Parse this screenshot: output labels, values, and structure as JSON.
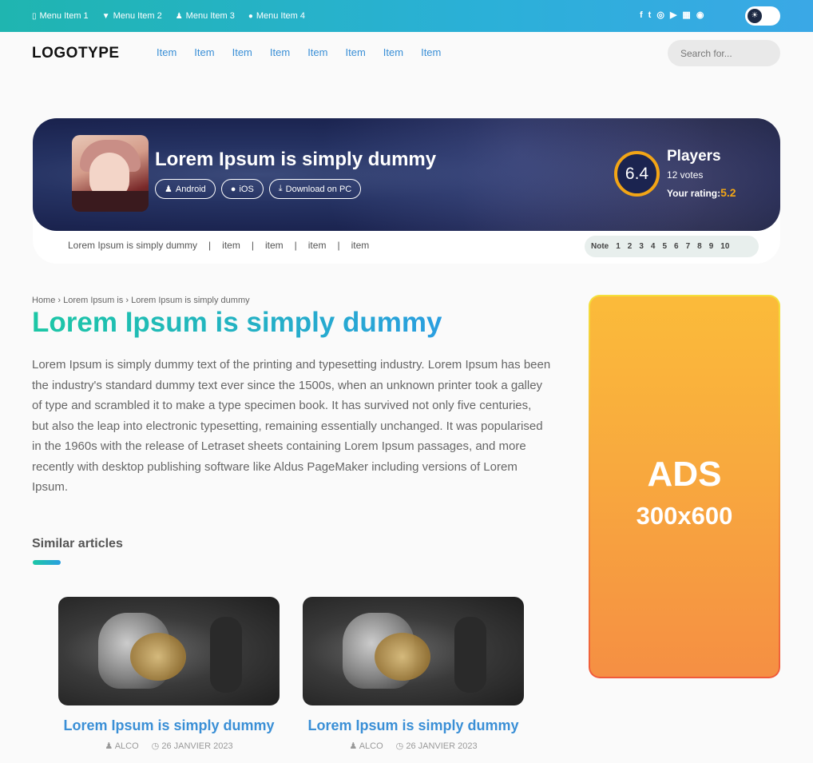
{
  "topbar": {
    "menu": [
      {
        "icon": "mobile-icon",
        "glyph": "▯",
        "label": "Menu Item 1"
      },
      {
        "icon": "filter-icon",
        "glyph": "▼",
        "label": "Menu Item 2"
      },
      {
        "icon": "android-icon",
        "glyph": "♟",
        "label": "Menu Item 3"
      },
      {
        "icon": "apple-icon",
        "glyph": "●",
        "label": "Menu Item 4"
      }
    ],
    "socials": [
      {
        "icon": "facebook-icon",
        "glyph": "f"
      },
      {
        "icon": "twitter-icon",
        "glyph": "t"
      },
      {
        "icon": "instagram-icon",
        "glyph": "◎"
      },
      {
        "icon": "youtube-icon",
        "glyph": "▶"
      },
      {
        "icon": "store-icon",
        "glyph": "▦"
      },
      {
        "icon": "rss-icon",
        "glyph": "◉"
      }
    ],
    "theme_toggle_glyph": "☀"
  },
  "header": {
    "logo": "LOGOTYPE",
    "nav": [
      "Item",
      "Item",
      "Item",
      "Item",
      "Item",
      "Item",
      "Item",
      "Item"
    ],
    "search_placeholder": "Search for..."
  },
  "game": {
    "title": "Lorem Ipsum is simply dummy",
    "platforms": [
      {
        "icon": "android-icon",
        "glyph": "♟",
        "label": "Android"
      },
      {
        "icon": "apple-icon",
        "glyph": "●",
        "label": "iOS"
      },
      {
        "icon": "download-icon",
        "glyph": "⤓",
        "label": "Download on PC"
      }
    ],
    "score": "6.4",
    "players_label": "Players",
    "votes": "12 votes",
    "your_rating_label": "Your rating:",
    "your_rating_value": "5.2",
    "subnav": [
      "Lorem Ipsum is simply dummy",
      "item",
      "item",
      "item",
      "item"
    ],
    "note_label": "Note",
    "notes": [
      "1",
      "2",
      "3",
      "4",
      "5",
      "6",
      "7",
      "8",
      "9",
      "10"
    ]
  },
  "article": {
    "breadcrumb": "Home › Lorem Ipsum is › Lorem Ipsum is simply dummy",
    "title": "Lorem Ipsum is simply dummy",
    "body": "Lorem Ipsum is simply dummy text of the printing and typesetting industry. Lorem Ipsum has been the industry's standard dummy text ever since the 1500s, when an unknown printer took a galley of type and scrambled it to make a type specimen book. It has survived not only five centuries, but also the leap into electronic typesetting, remaining essentially unchanged. It was popularised in the 1960s with the release of Letraset sheets containing Lorem Ipsum passages, and more recently with desktop publishing software like Aldus PageMaker including versions of Lorem Ipsum.",
    "similar_heading": "Similar articles",
    "cards": [
      {
        "title": "Lorem Ipsum is simply dummy",
        "author": "ALCO",
        "date": "26 JANVIER 2023"
      },
      {
        "title": "Lorem Ipsum is simply dummy",
        "author": "ALCO",
        "date": "26 JANVIER 2023"
      }
    ]
  },
  "ad": {
    "line1": "ADS",
    "line2": "300x600"
  },
  "colors": {
    "accent_teal": "#1cc7a5",
    "accent_blue": "#2a9ee0",
    "rating_orange": "#f2a516",
    "banner_dark": "#1b2450"
  }
}
